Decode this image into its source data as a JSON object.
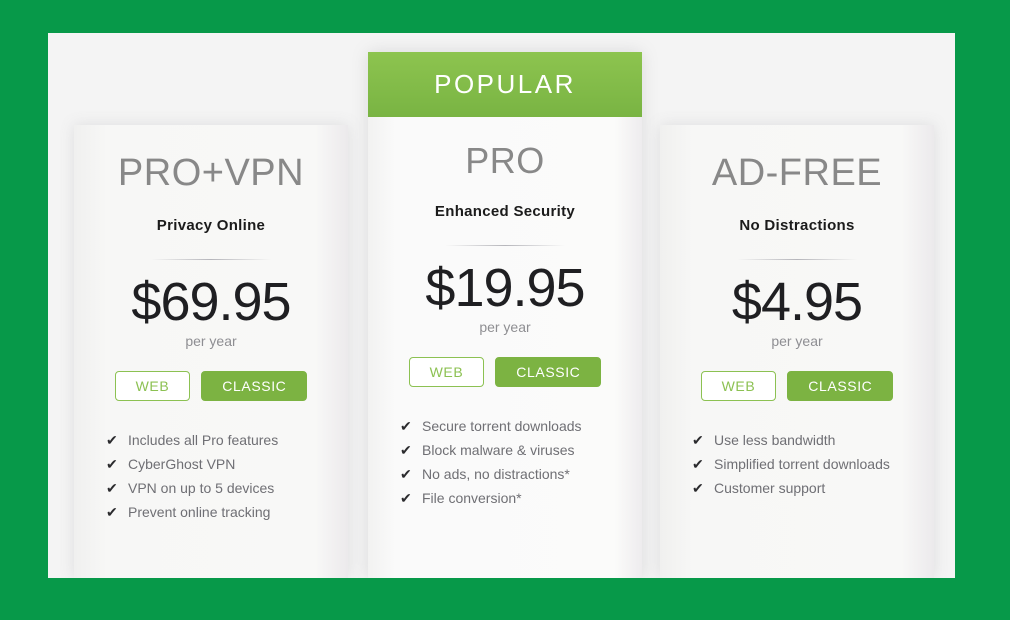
{
  "theme": {
    "page_background": "#079949",
    "panel_background": "#f4f4f4",
    "banner_green": "#7cb342",
    "button_green": "#7cb342",
    "button_outline_green": "#8cc152",
    "plan_name_color": "#888888",
    "price_color": "#1f1f22",
    "feature_text_color": "#6f6f74"
  },
  "banner": {
    "label": "POPULAR"
  },
  "plans": [
    {
      "id": "pro-vpn",
      "name": "PRO+VPN",
      "tagline": "Privacy Online",
      "price": "$69.95",
      "period": "per year",
      "buttons": {
        "web": "WEB",
        "classic": "CLASSIC"
      },
      "check_icon": "✔",
      "features": [
        "Includes all Pro features",
        "CyberGhost VPN",
        "VPN on up to 5 devices",
        "Prevent online tracking"
      ]
    },
    {
      "id": "pro",
      "name": "PRO",
      "tagline": "Enhanced Security",
      "price": "$19.95",
      "period": "per year",
      "buttons": {
        "web": "WEB",
        "classic": "CLASSIC"
      },
      "check_icon": "✔",
      "features": [
        "Secure torrent downloads",
        "Block malware & viruses",
        "No ads, no distractions*",
        "File conversion*"
      ]
    },
    {
      "id": "ad-free",
      "name": "AD-FREE",
      "tagline": "No Distractions",
      "price": "$4.95",
      "period": "per year",
      "buttons": {
        "web": "WEB",
        "classic": "CLASSIC"
      },
      "check_icon": "✔",
      "features": [
        "Use less bandwidth",
        "Simplified torrent downloads",
        "Customer support"
      ]
    }
  ]
}
